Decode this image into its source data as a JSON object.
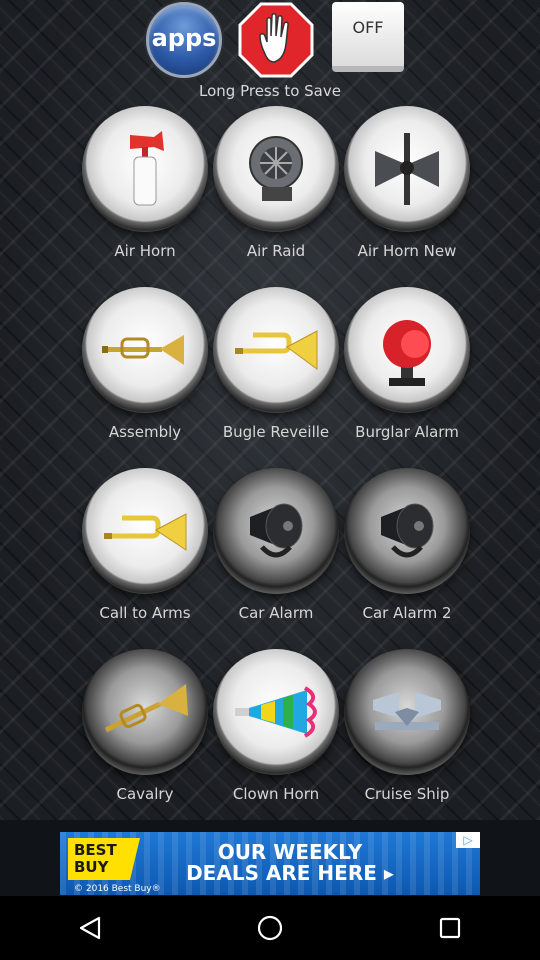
{
  "header": {
    "apps_label": "apps",
    "toggle_label": "OFF",
    "hint": "Long Press to Save"
  },
  "sounds": [
    {
      "label": "Air Horn",
      "icon": "air-horn-can-icon"
    },
    {
      "label": "Air Raid",
      "icon": "air-raid-siren-icon"
    },
    {
      "label": "Air Horn New",
      "icon": "horn-speaker-icon"
    },
    {
      "label": "Assembly",
      "icon": "trumpet-icon"
    },
    {
      "label": "Bugle Reveille",
      "icon": "bugle-icon"
    },
    {
      "label": "Burglar Alarm",
      "icon": "red-alarm-siren-icon"
    },
    {
      "label": "Call to Arms",
      "icon": "bugle-icon"
    },
    {
      "label": "Car Alarm",
      "icon": "car-alarm-siren-icon"
    },
    {
      "label": "Car Alarm 2",
      "icon": "car-alarm-siren-icon"
    },
    {
      "label": "Cavalry",
      "icon": "trumpet-icon"
    },
    {
      "label": "Clown Horn",
      "icon": "party-horn-icon"
    },
    {
      "label": "Cruise Ship",
      "icon": "ship-horns-icon"
    }
  ],
  "ad": {
    "brand": "BEST BUY",
    "headline_line1": "OUR WEEKLY",
    "headline_line2": "DEALS ARE HERE ▸",
    "legal": "© 2016 Best Buy®"
  },
  "colors": {
    "apps_blue": "#2d5aa8",
    "stop_red": "#e0262a",
    "ad_blue": "#1f78d6",
    "ad_yellow": "#ffe000"
  }
}
